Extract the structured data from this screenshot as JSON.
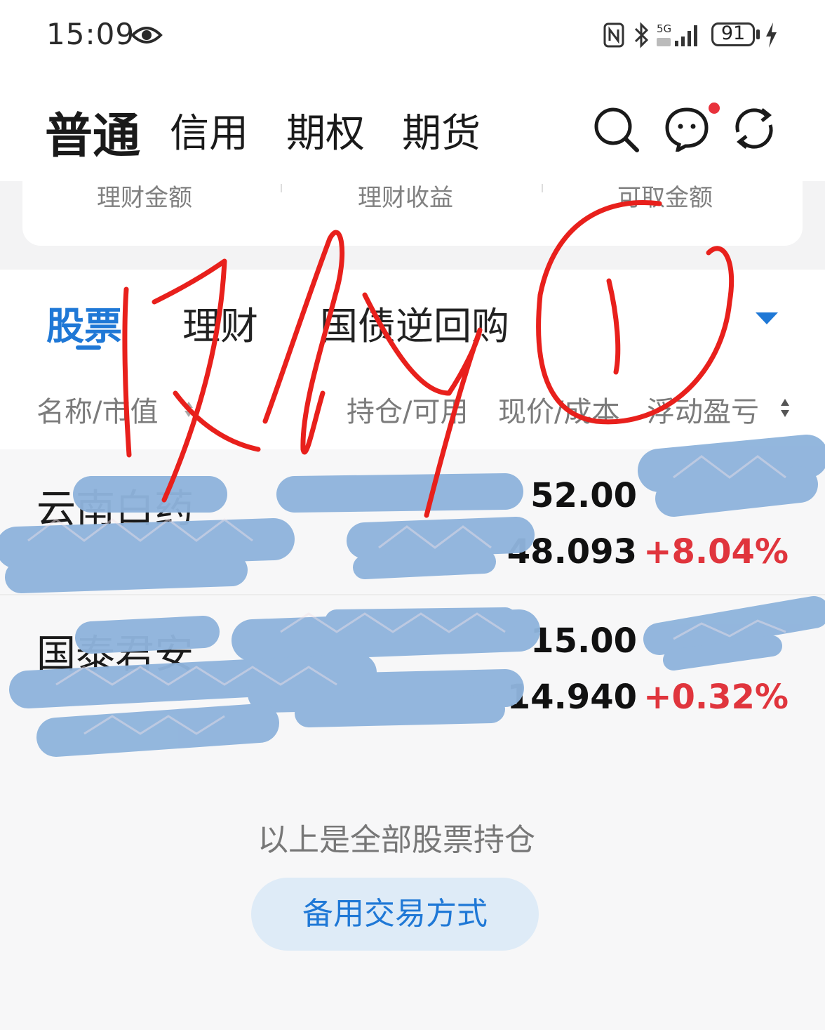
{
  "status_bar": {
    "time": "15:09",
    "battery": "91",
    "network": "5G"
  },
  "header": {
    "tabs": [
      {
        "label": "普通"
      },
      {
        "label": "信用"
      },
      {
        "label": "期权"
      },
      {
        "label": "期货"
      }
    ]
  },
  "summary": {
    "labels": [
      "理财金额",
      "理财收益",
      "可取金额"
    ]
  },
  "subtabs": [
    {
      "label": "股票"
    },
    {
      "label": "理财"
    },
    {
      "label": "国债逆回购"
    }
  ],
  "columns": {
    "name_value": "名称/市值",
    "holding_available": "持仓/可用",
    "price_cost": "现价/成本",
    "pnl": "浮动盈亏"
  },
  "holdings": [
    {
      "name": "云南白药",
      "price": "52.00",
      "cost": "48.093",
      "pnl_pct": "+8.04%"
    },
    {
      "name": "国泰君安",
      "price": "15.00",
      "cost": "14.940",
      "pnl_pct": "+0.32%"
    }
  ],
  "footer": {
    "end_text": "以上是全部股票持仓",
    "backup_button": "备用交易方式"
  },
  "colors": {
    "accent": "#1f78d6",
    "gain": "#e0353d",
    "notification_dot": "#e8323c",
    "redaction": "#8fb4dc",
    "handwriting": "#e8201c"
  },
  "icons": {
    "search": "search-icon",
    "message": "message-bubble-icon",
    "refresh": "refresh-icon",
    "dropdown": "triangle-down-icon"
  }
}
